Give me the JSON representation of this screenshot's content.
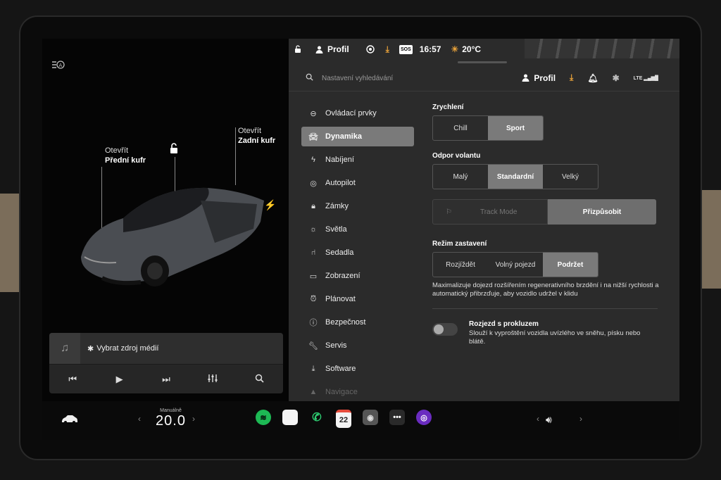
{
  "car": {
    "frunk_action": "Otevřít",
    "frunk_label": "Přední kufr",
    "trunk_action": "Otevřít",
    "trunk_label": "Zadní kufr"
  },
  "media": {
    "source_label": "Vybrat zdroj médií",
    "icons": [
      "music-note-icon",
      "bluetooth-icon",
      "previous-icon",
      "play-icon",
      "next-icon",
      "equalizer-icon",
      "search-icon"
    ]
  },
  "status_bar": {
    "profile": "Profil",
    "time": "16:57",
    "temperature": "20°C",
    "sos": "SOS"
  },
  "search": {
    "placeholder": "Nastavení vyhledávání",
    "profile": "Profil",
    "lte": "LTE"
  },
  "menu": {
    "items": [
      {
        "label": "Ovládací prvky",
        "icon": "toggle-icon"
      },
      {
        "label": "Dynamika",
        "icon": "car-icon",
        "active": true
      },
      {
        "label": "Nabíjení",
        "icon": "bolt-icon"
      },
      {
        "label": "Autopilot",
        "icon": "steering-wheel-icon"
      },
      {
        "label": "Zámky",
        "icon": "lock-icon"
      },
      {
        "label": "Světla",
        "icon": "sun-icon"
      },
      {
        "label": "Sedadla",
        "icon": "seat-icon"
      },
      {
        "label": "Zobrazení",
        "icon": "display-icon"
      },
      {
        "label": "Plánovat",
        "icon": "alarm-icon"
      },
      {
        "label": "Bezpečnost",
        "icon": "info-icon"
      },
      {
        "label": "Servis",
        "icon": "wrench-icon"
      },
      {
        "label": "Software",
        "icon": "download-icon"
      },
      {
        "label": "Navigace",
        "icon": "navigation-icon"
      }
    ]
  },
  "dynamics": {
    "acceleration": {
      "label": "Zrychlení",
      "options": [
        "Chill",
        "Sport"
      ],
      "selected": "Sport"
    },
    "steering": {
      "label": "Odpor volantu",
      "options": [
        "Malý",
        "Standardní",
        "Velký"
      ],
      "selected": "Standardní"
    },
    "track_mode": {
      "label": "Track Mode",
      "customize": "Přizpůsobit"
    },
    "stopping": {
      "label": "Režim zastavení",
      "options": [
        "Rozjíždět",
        "Volný pojezd",
        "Podržet"
      ],
      "selected": "Podržet",
      "description": "Maximalizuje dojezd rozšířením regenerativního brzdění i na nižší rychlosti a automatický přibrzďuje, aby vozidlo udržel v klidu"
    },
    "slip_start": {
      "label": "Rozjezd s prokluzem",
      "description": "Slouží k vyproštění vozidla uvízlého ve sněhu, písku nebo blátě.",
      "enabled": false
    }
  },
  "dock": {
    "climate_label": "Manuálně",
    "temperature": "20.0",
    "calendar_day": "22",
    "apps": [
      "spotify-icon",
      "notes-icon",
      "phone-icon",
      "calendar-icon",
      "camera-icon",
      "more-icon",
      "toybox-icon"
    ]
  },
  "colors": {
    "selected": "#7a7a7a",
    "panel": "#2b2b2b",
    "accent_orange": "#e8a23a",
    "spotify": "#1db954"
  }
}
